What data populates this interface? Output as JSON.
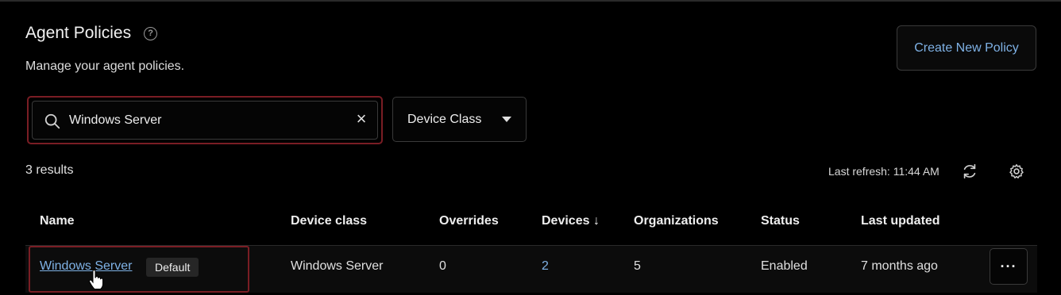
{
  "header": {
    "title": "Agent Policies",
    "subtitle": "Manage your agent policies.",
    "help_icon": "question-circle-icon",
    "create_button_label": "Create New Policy"
  },
  "filters": {
    "search_value": "Windows Server",
    "search_icon": "search-icon",
    "clear_icon": "close-icon",
    "device_class_label": "Device Class",
    "device_class_icon": "caret-down-icon"
  },
  "toolbar": {
    "results_text": "3 results",
    "last_refresh_text": "Last refresh: 11:44 AM",
    "refresh_icon": "refresh-icon",
    "settings_icon": "gear-icon"
  },
  "table": {
    "columns": [
      "Name",
      "Device class",
      "Overrides",
      "Devices ↓",
      "Organizations",
      "Status",
      "Last updated"
    ],
    "rows": [
      {
        "name": "Windows Server",
        "badge": "Default",
        "device_class": "Windows Server",
        "overrides": "0",
        "devices": "2",
        "organizations": "5",
        "status": "Enabled",
        "last_updated": "7 months ago",
        "actions_label": "···"
      }
    ]
  },
  "colors": {
    "accent_link": "#7fb2e6",
    "highlight_frame": "#7a1d24",
    "background": "#000000"
  }
}
